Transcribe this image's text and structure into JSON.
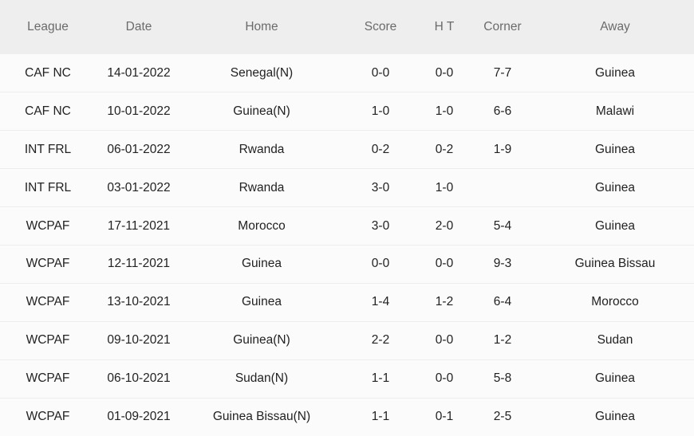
{
  "table": {
    "columns": [
      {
        "key": "league",
        "label": "League"
      },
      {
        "key": "date",
        "label": "Date"
      },
      {
        "key": "home",
        "label": "Home"
      },
      {
        "key": "score",
        "label": "Score"
      },
      {
        "key": "ht",
        "label": "H T"
      },
      {
        "key": "corner",
        "label": "Corner"
      },
      {
        "key": "away",
        "label": "Away"
      }
    ],
    "colors": {
      "header_bg": "#eeeeee",
      "header_text": "#6b6b6b",
      "row_bg": "#fbfbfb",
      "row_divider": "#ededed",
      "body_text": "#222222",
      "score_red": "#c2403c",
      "team_link_blue": "#5b9bd5"
    },
    "rows": [
      {
        "league": "CAF NC",
        "date": "14-01-2022",
        "home": "Senegal(N)",
        "home_highlight": false,
        "score": "0-0",
        "ht": "0-0",
        "corner": "7-7",
        "away": "Guinea",
        "away_highlight": true
      },
      {
        "league": "CAF NC",
        "date": "10-01-2022",
        "home": "Guinea(N)",
        "home_highlight": true,
        "score": "1-0",
        "ht": "1-0",
        "corner": "6-6",
        "away": "Malawi",
        "away_highlight": false
      },
      {
        "league": "INT FRL",
        "date": "06-01-2022",
        "home": "Rwanda",
        "home_highlight": false,
        "score": "0-2",
        "ht": "0-2",
        "corner": "1-9",
        "away": "Guinea",
        "away_highlight": true
      },
      {
        "league": "INT FRL",
        "date": "03-01-2022",
        "home": "Rwanda",
        "home_highlight": false,
        "score": "3-0",
        "ht": "1-0",
        "corner": "",
        "away": "Guinea",
        "away_highlight": true
      },
      {
        "league": "WCPAF",
        "date": "17-11-2021",
        "home": "Morocco",
        "home_highlight": false,
        "score": "3-0",
        "ht": "2-0",
        "corner": "5-4",
        "away": "Guinea",
        "away_highlight": true
      },
      {
        "league": "WCPAF",
        "date": "12-11-2021",
        "home": "Guinea",
        "home_highlight": true,
        "score": "0-0",
        "ht": "0-0",
        "corner": "9-3",
        "away": "Guinea Bissau",
        "away_highlight": false
      },
      {
        "league": "WCPAF",
        "date": "13-10-2021",
        "home": "Guinea",
        "home_highlight": true,
        "score": "1-4",
        "ht": "1-2",
        "corner": "6-4",
        "away": "Morocco",
        "away_highlight": false
      },
      {
        "league": "WCPAF",
        "date": "09-10-2021",
        "home": "Guinea(N)",
        "home_highlight": true,
        "score": "2-2",
        "ht": "0-0",
        "corner": "1-2",
        "away": "Sudan",
        "away_highlight": false
      },
      {
        "league": "WCPAF",
        "date": "06-10-2021",
        "home": "Sudan(N)",
        "home_highlight": false,
        "score": "1-1",
        "ht": "0-0",
        "corner": "5-8",
        "away": "Guinea",
        "away_highlight": true
      },
      {
        "league": "WCPAF",
        "date": "01-09-2021",
        "home": "Guinea Bissau(N)",
        "home_highlight": false,
        "score": "1-1",
        "ht": "0-1",
        "corner": "2-5",
        "away": "Guinea",
        "away_highlight": true
      }
    ]
  }
}
